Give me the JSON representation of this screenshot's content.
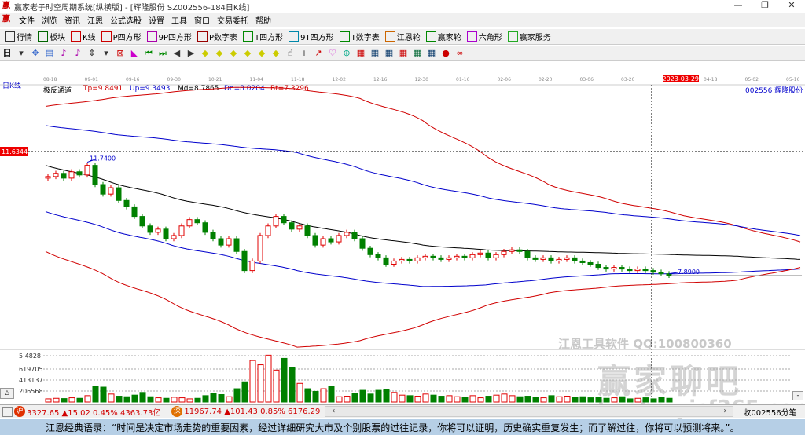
{
  "window": {
    "title": "赢家老子时空周期系统[纵横版] - [辉隆股份  SZ002556-184日K线]",
    "controls": [
      "—",
      "❐",
      "✕"
    ]
  },
  "menu": [
    "文件",
    "浏览",
    "资讯",
    "江恩",
    "公式选股",
    "设置",
    "工具",
    "窗口",
    "交易委托",
    "帮助"
  ],
  "toolbar1": [
    {
      "icon": "grid-icon",
      "label": "行情"
    },
    {
      "icon": "blocks-icon",
      "label": "板块"
    },
    {
      "icon": "kline-icon",
      "label": "K线"
    },
    {
      "icon": "PS",
      "label": "P四方形"
    },
    {
      "icon": "P9",
      "label": "9P四方形"
    },
    {
      "icon": "PN",
      "label": "P数字表"
    },
    {
      "icon": "TS",
      "label": "T四方形"
    },
    {
      "icon": "T9",
      "label": "9T四方形"
    },
    {
      "icon": "TN",
      "label": "T数字表"
    },
    {
      "icon": "target-icon",
      "label": "江恩轮"
    },
    {
      "icon": "wheel-icon",
      "label": "赢家轮"
    },
    {
      "icon": "hexagon-icon",
      "label": "六角形"
    },
    {
      "icon": "dollar-icon",
      "label": "赢家服务"
    }
  ],
  "toolbar2": {
    "period": "日",
    "icons": [
      "▾",
      "✥",
      "▤",
      "♪",
      "♪",
      "⇕",
      "▾",
      "⊠",
      "◣",
      "⏮",
      "⏭",
      "◀",
      "▶",
      "◆",
      "◆",
      "◆",
      "◆",
      "◆",
      "◆",
      "☝",
      "+",
      "↗",
      "♡",
      "⊕",
      "▦",
      "▦",
      "▦",
      "▦",
      "▦",
      "▦",
      "●",
      "∞"
    ]
  },
  "chart": {
    "period_label": "日K线",
    "date_ticks": [
      "08-18",
      "09-01",
      "09-16",
      "09-30",
      "10-21",
      "11-04",
      "11-18",
      "12-02",
      "12-16",
      "12-30",
      "01-16",
      "02-06",
      "02-20",
      "03-06",
      "03-20",
      "2023-03-29",
      "04-18",
      "05-02",
      "05-16"
    ],
    "indicator": {
      "name": "极反通道",
      "Tp": "Tp=9.8491",
      "Up": "Up=9.3493",
      "Md": "Md=8.7865",
      "Dn": "Dn=8.0204",
      "Bt": "Bt=7.3296"
    },
    "stock": "002556  辉隆股份",
    "cursor_price": "11.6344",
    "high_label": "11.7400",
    "low_label": "7.8900",
    "colors": {
      "up": "#e00000",
      "down": "#008000",
      "tp": "#d00000",
      "up_band": "#0000cc",
      "md": "#000000",
      "dn": "#0000cc",
      "bt": "#d00000"
    }
  },
  "chart_data": {
    "type": "candlestick",
    "close": [
      10.85,
      10.95,
      10.8,
      11.0,
      10.9,
      11.2,
      10.6,
      10.3,
      10.5,
      10.1,
      9.9,
      9.6,
      9.3,
      9.1,
      9.2,
      8.9,
      9.0,
      9.3,
      9.5,
      9.4,
      9.1,
      8.9,
      8.7,
      8.9,
      8.5,
      7.9,
      8.2,
      9.0,
      9.3,
      9.6,
      9.4,
      9.2,
      9.3,
      9.0,
      8.7,
      8.9,
      8.8,
      9.0,
      9.1,
      8.9,
      8.6,
      8.4,
      8.3,
      8.1,
      8.2,
      8.25,
      8.2,
      8.3,
      8.35,
      8.3,
      8.25,
      8.3,
      8.35,
      8.3,
      8.4,
      8.45,
      8.3,
      8.4,
      8.5,
      8.55,
      8.5,
      8.3,
      8.25,
      8.3,
      8.2,
      8.25,
      8.3,
      8.2,
      8.15,
      8.1,
      8.0,
      7.95,
      8.0,
      7.95,
      7.9,
      7.95,
      7.9,
      7.85,
      7.8,
      7.75
    ],
    "volume": [
      60000,
      70000,
      65000,
      80000,
      70000,
      120000,
      300000,
      280000,
      150000,
      110000,
      100000,
      130000,
      180000,
      100000,
      80000,
      70000,
      90000,
      80000,
      60000,
      70000,
      120000,
      160000,
      140000,
      100000,
      250000,
      380000,
      780000,
      700000,
      880000,
      600000,
      820000,
      650000,
      350000,
      250000,
      200000,
      250000,
      300000,
      100000,
      110000,
      160000,
      220000,
      150000,
      220000,
      240000,
      180000,
      130000,
      120000,
      110000,
      150000,
      130000,
      110000,
      120000,
      100000,
      90000,
      120000,
      80000,
      110000,
      130000,
      150000,
      120000,
      100000,
      110000,
      90000,
      80000,
      120000,
      100000,
      110000,
      90000,
      100000,
      80000,
      90000,
      70000,
      80000,
      100000,
      60000,
      70000,
      80000,
      60000,
      90000,
      70000
    ],
    "volume_ticks": [
      "5.4828",
      "619705",
      "413137",
      "206568"
    ],
    "bands": {
      "Tp": [
        13.05,
        13.3,
        13.5,
        13.65,
        13.6,
        13.3,
        12.6,
        11.5,
        10.6,
        10.1,
        9.7,
        9.3,
        8.8
      ],
      "Up": [
        12.45,
        12.2,
        12.0,
        11.8,
        11.6,
        11.1,
        10.6,
        10.2,
        9.9,
        9.7,
        9.5,
        9.3,
        9.0
      ],
      "Md": [
        11.2,
        10.7,
        10.2,
        9.8,
        9.4,
        9.0,
        8.7,
        8.55,
        8.5,
        8.45,
        8.4,
        8.35,
        8.25
      ],
      "Dn": [
        9.75,
        9.2,
        8.7,
        8.3,
        7.9,
        7.6,
        7.4,
        7.45,
        7.65,
        7.8,
        7.8,
        7.85,
        7.95
      ],
      "Bt": [
        8.5,
        7.7,
        6.9,
        6.1,
        5.5,
        5.7,
        6.2,
        6.8,
        7.2,
        7.4,
        7.5,
        7.6,
        8.0
      ]
    }
  },
  "watermark": {
    "line1": "江恩工具软件  QQ:100800360",
    "line2": "赢家聊吧",
    "line3": "liaoba.yicf365.com"
  },
  "status": {
    "sh": "3327.65 ▲15.02 0.45% 4363.73亿",
    "sz": "11967.74 ▲101.43 0.85% 6176.29",
    "right": "收002556分笔",
    "sh_badge": "沪",
    "sz_badge": "深"
  },
  "quote": "江恩经典语录：“时间是决定市场走势的重要因素，经过详细研究大市及个别股票的过往记录，你将可以证明，历史确实重复发生；而了解过往，你将可以预测将来。”。"
}
